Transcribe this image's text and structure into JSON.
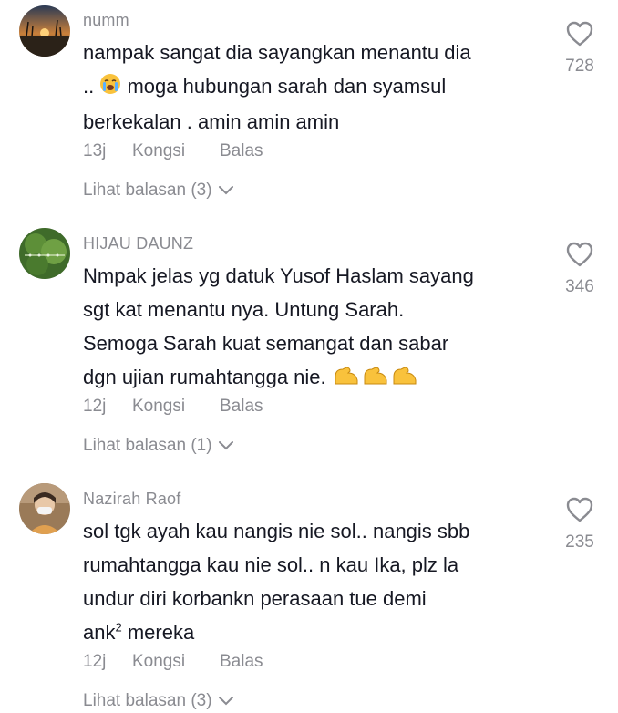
{
  "comments": [
    {
      "username": "numm",
      "lines": [
        "nampak sangat dia sayangkan menantu dia",
        "moga hubungan sarah dan syamsul",
        "berkekalan . amin amin amin"
      ],
      "line1_prefix": "..",
      "time": "13j",
      "share_label": "Kongsi",
      "reply_label": "Balas",
      "view_replies": "Lihat balasan (3)",
      "likes": "728"
    },
    {
      "username": "HIJAU DAUNZ",
      "lines": [
        "Nmpak jelas yg datuk Yusof Haslam sayang",
        "sgt kat menantu nya. Untung Sarah.",
        "Semoga Sarah kuat semangat dan sabar",
        "dgn ujian rumahtangga nie."
      ],
      "time": "12j",
      "share_label": "Kongsi",
      "reply_label": "Balas",
      "view_replies": "Lihat balasan (1)",
      "likes": "346"
    },
    {
      "username": "Nazirah Raof",
      "lines": [
        "sol tgk ayah kau nangis nie sol.. nangis sbb",
        "rumahtangga kau nie sol.. n kau Ika, plz la",
        "undur diri korbankn perasaan tue demi",
        "ank"
      ],
      "superscript": "2",
      "last_line_suffix": "mereka",
      "time": "12j",
      "share_label": "Kongsi",
      "reply_label": "Balas",
      "view_replies": "Lihat balasan (3)",
      "likes": "235"
    }
  ],
  "icons": {
    "like": "heart-outline-icon",
    "expand": "chevron-down-icon",
    "emoji_crying": "loudly-crying-face-emoji",
    "emoji_muscle": "flexed-biceps-emoji"
  },
  "colors": {
    "text": "#161823",
    "muted": "#8a8b91",
    "background": "#ffffff"
  }
}
